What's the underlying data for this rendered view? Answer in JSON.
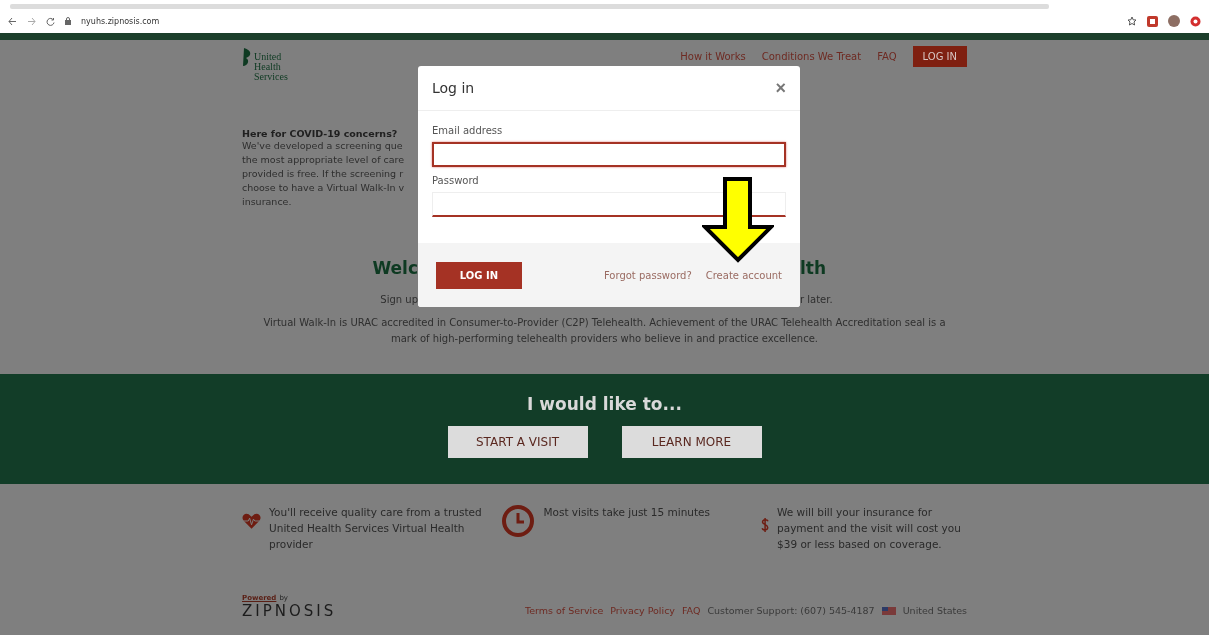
{
  "browser": {
    "url": "nyuhs.zipnosis.com"
  },
  "header": {
    "logo": [
      "United",
      "Health",
      "Services"
    ],
    "nav": [
      {
        "label": "How it Works"
      },
      {
        "label": "Conditions We Treat"
      },
      {
        "label": "FAQ"
      }
    ],
    "login_button": "LOG IN"
  },
  "covid": {
    "heading": "Here for COVID-19 concerns?",
    "lines": [
      "We've developed a screening que",
      "the most appropriate level of care",
      "provided is free. If the screening r",
      "choose to have a Virtual Walk-In v",
      "insurance."
    ]
  },
  "welcome": {
    "heading_left": "Welc",
    "heading_right": "lth",
    "sub_left": "Sign up",
    "sub_right": "r later."
  },
  "accreditation": "Virtual Walk-In is URAC accredited in Consumer-to-Provider (C2P) Telehealth. Achievement of the URAC Telehealth Accreditation seal is a mark of high-performing telehealth providers who believe in and practice excellence.",
  "action_band": {
    "heading": "I would like to...",
    "buttons": [
      "START A VISIT",
      "LEARN MORE"
    ]
  },
  "features": [
    {
      "kind": "heart",
      "text": "You'll receive quality care from a trusted United Health Services Virtual Health provider"
    },
    {
      "kind": "clock",
      "text": "Most visits take just 15 minutes"
    },
    {
      "kind": "dollar",
      "text": "We will bill your insurance for payment and the visit will cost you $39 or less based on coverage."
    }
  ],
  "footer": {
    "powered": "Powered",
    "by": "by",
    "brand": "ZIPNOSIS",
    "links": [
      "Terms of Service",
      "Privacy Policy",
      "FAQ"
    ],
    "support": "Customer Support: (607) 545-4187",
    "country": "United States"
  },
  "modal": {
    "title": "Log in",
    "close": "×",
    "fields": [
      {
        "label": "Email address",
        "focused": true
      },
      {
        "label": "Password",
        "focused": false
      }
    ],
    "submit": "LOG IN",
    "links": [
      "Forgot password?",
      "Create account"
    ]
  }
}
